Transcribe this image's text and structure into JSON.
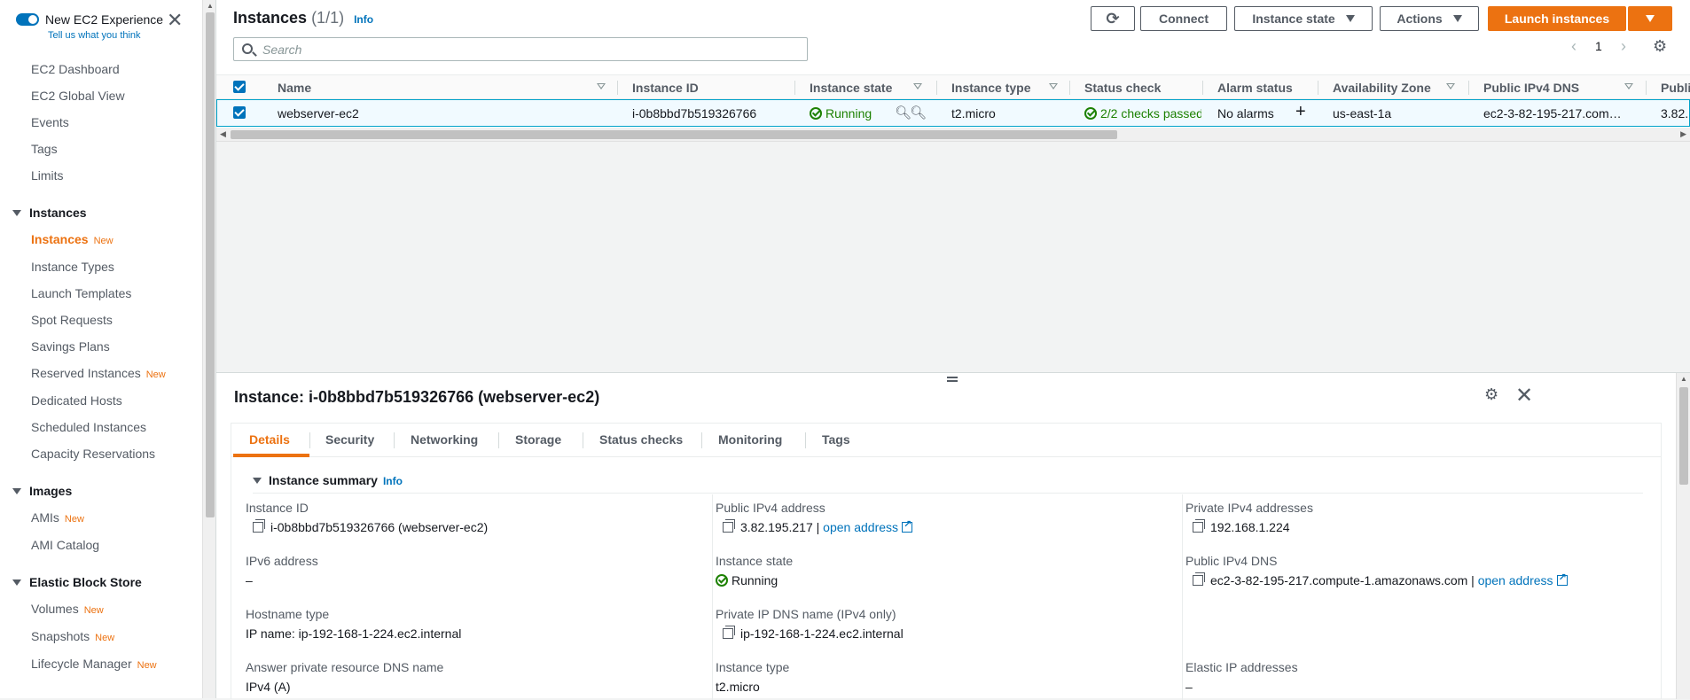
{
  "sidebar": {
    "toggle_title": "New EC2 Experience",
    "toggle_sub": "Tell us what you think",
    "items": [
      {
        "label": "EC2 Dashboard"
      },
      {
        "label": "EC2 Global View"
      },
      {
        "label": "Events"
      },
      {
        "label": "Tags"
      },
      {
        "label": "Limits"
      }
    ],
    "sections": [
      {
        "label": "Instances",
        "items": [
          {
            "label": "Instances",
            "badge": "New"
          },
          {
            "label": "Instance Types"
          },
          {
            "label": "Launch Templates"
          },
          {
            "label": "Spot Requests"
          },
          {
            "label": "Savings Plans"
          },
          {
            "label": "Reserved Instances",
            "badge": "New"
          },
          {
            "label": "Dedicated Hosts"
          },
          {
            "label": "Scheduled Instances"
          },
          {
            "label": "Capacity Reservations"
          }
        ]
      },
      {
        "label": "Images",
        "items": [
          {
            "label": "AMIs",
            "badge": "New"
          },
          {
            "label": "AMI Catalog"
          }
        ]
      },
      {
        "label": "Elastic Block Store",
        "items": [
          {
            "label": "Volumes",
            "badge": "New"
          },
          {
            "label": "Snapshots",
            "badge": "New"
          },
          {
            "label": "Lifecycle Manager",
            "badge": "New"
          }
        ]
      }
    ]
  },
  "list": {
    "title": "Instances",
    "count": "(1/1)",
    "info": "Info",
    "connect": "Connect",
    "instance_state": "Instance state",
    "actions": "Actions",
    "launch": "Launch instances",
    "search_placeholder": "Search",
    "page": "1"
  },
  "table": {
    "headers": [
      "Name",
      "Instance ID",
      "Instance state",
      "Instance type",
      "Status check",
      "Alarm status",
      "Availability Zone",
      "Public IPv4 DNS",
      "Publi"
    ],
    "row": {
      "name": "webserver-ec2",
      "id": "i-0b8bbd7b519326766",
      "state": "Running",
      "type": "t2.micro",
      "status": "2/2 checks passed",
      "alarm": "No alarms",
      "az": "us-east-1a",
      "dns": "ec2-3-82-195-217.com…",
      "ip": "3.82."
    }
  },
  "detail": {
    "title": "Instance: i-0b8bbd7b519326766 (webserver-ec2)",
    "tabs": [
      "Details",
      "Security",
      "Networking",
      "Storage",
      "Status checks",
      "Monitoring",
      "Tags"
    ],
    "summary": "Instance summary",
    "info": "Info",
    "open_address": "open address",
    "fields": {
      "instance_id_label": "Instance ID",
      "instance_id": "i-0b8bbd7b519326766 (webserver-ec2)",
      "public_ipv4_label": "Public IPv4 address",
      "public_ipv4": "3.82.195.217",
      "private_ipv4_label": "Private IPv4 addresses",
      "private_ipv4": "192.168.1.224",
      "ipv6_label": "IPv6 address",
      "ipv6": "–",
      "state_label": "Instance state",
      "state": "Running",
      "public_dns_label": "Public IPv4 DNS",
      "public_dns": "ec2-3-82-195-217.compute-1.amazonaws.com",
      "hostname_type_label": "Hostname type",
      "hostname_type": "IP name: ip-192-168-1-224.ec2.internal",
      "private_dns_label": "Private IP DNS name (IPv4 only)",
      "private_dns": "ip-192-168-1-224.ec2.internal",
      "answer_dns_label": "Answer private resource DNS name",
      "answer_dns": "IPv4 (A)",
      "instance_type_label": "Instance type",
      "instance_type": "t2.micro",
      "elastic_ip_label": "Elastic IP addresses",
      "elastic_ip": "–"
    }
  }
}
